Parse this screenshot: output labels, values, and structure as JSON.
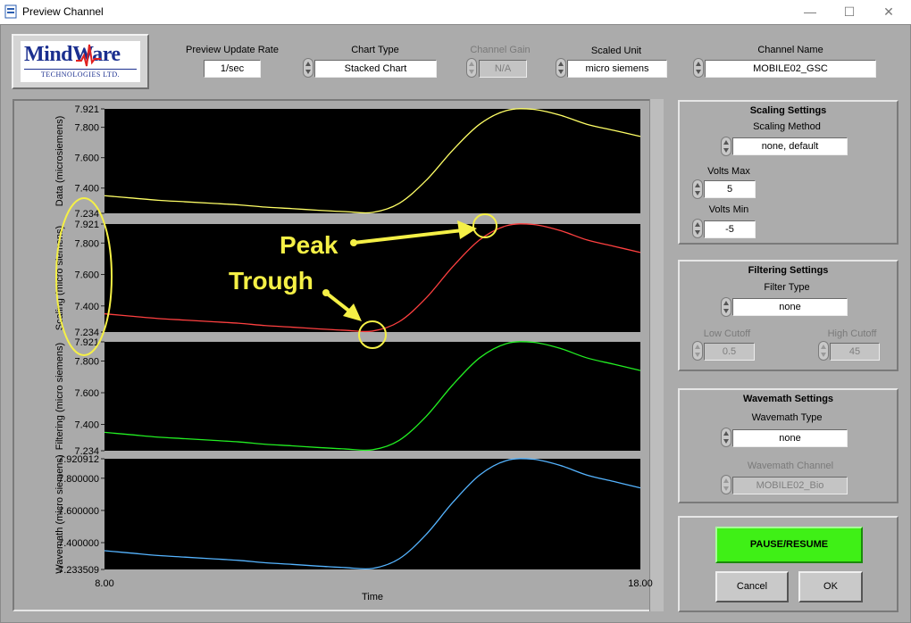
{
  "window": {
    "title": "Preview Channel",
    "minimize": "—",
    "maximize": "☐",
    "close": "✕"
  },
  "logo": {
    "name": "MindWare",
    "subtitle": "TECHNOLOGIES LTD."
  },
  "toolbar": {
    "update_rate": {
      "label": "Preview Update Rate",
      "value": "1/sec"
    },
    "chart_type": {
      "label": "Chart Type",
      "value": "Stacked Chart"
    },
    "channel_gain": {
      "label": "Channel Gain",
      "value": "N/A"
    },
    "scaled_unit": {
      "label": "Scaled Unit",
      "value": "micro siemens"
    },
    "channel_name": {
      "label": "Channel Name",
      "value": "MOBILE02_GSC"
    }
  },
  "scaling": {
    "title": "Scaling Settings",
    "method_label": "Scaling Method",
    "method_value": "none, default",
    "vmax_label": "Volts Max",
    "vmax_value": "5",
    "vmin_label": "Volts Min",
    "vmin_value": "-5"
  },
  "filtering": {
    "title": "Filtering Settings",
    "type_label": "Filter Type",
    "type_value": "none",
    "low_label": "Low Cutoff",
    "low_value": "0.5",
    "high_label": "High Cutoff",
    "high_value": "45"
  },
  "wavemath": {
    "title": "Wavemath Settings",
    "type_label": "Wavemath Type",
    "type_value": "none",
    "channel_label": "Wavemath Channel",
    "channel_value": "MOBILE02_Bio"
  },
  "buttons": {
    "pause": "PAUSE/RESUME",
    "cancel": "Cancel",
    "ok": "OK"
  },
  "annotations": {
    "peak": "Peak",
    "trough": "Trough"
  },
  "colors": {
    "data": "#ffff66",
    "scaling": "#ff4040",
    "filtering": "#22ee22",
    "wavemath": "#55b4ff",
    "annotation": "#f5f046",
    "pause_button": "#3ff016"
  },
  "chart_data": {
    "type": "line",
    "xlabel": "Time",
    "xlim": [
      8,
      18
    ],
    "x_tick_labels": [
      "8.00",
      "18.00"
    ],
    "x": [
      8,
      8.5,
      9,
      9.5,
      10,
      10.5,
      11,
      11.5,
      12,
      12.5,
      13,
      13.5,
      14,
      14.5,
      15,
      15.5,
      16,
      16.5,
      17,
      17.5,
      18
    ],
    "shape": [
      7.35,
      7.335,
      7.32,
      7.31,
      7.3,
      7.29,
      7.275,
      7.265,
      7.254,
      7.245,
      7.24,
      7.3,
      7.45,
      7.65,
      7.82,
      7.91,
      7.918,
      7.88,
      7.82,
      7.78,
      7.74
    ],
    "panels": [
      {
        "ylabel": "Data (microsiemens)",
        "ylim": [
          7.234,
          7.921
        ],
        "y_tick_labels": [
          "7.921",
          "7.800",
          "7.600",
          "7.400",
          "7.234"
        ],
        "y_ticks": [
          7.921,
          7.8,
          7.6,
          7.4,
          7.234
        ],
        "color": "#ffff66"
      },
      {
        "ylabel": "Scaling (micro siemens)",
        "ylim": [
          7.234,
          7.921
        ],
        "y_tick_labels": [
          "7.921",
          "7.800",
          "7.600",
          "7.400",
          "7.234"
        ],
        "y_ticks": [
          7.921,
          7.8,
          7.6,
          7.4,
          7.234
        ],
        "color": "#ff4040"
      },
      {
        "ylabel": "Filtering (micro siemens)",
        "ylim": [
          7.234,
          7.921
        ],
        "y_tick_labels": [
          "7.921",
          "7.800",
          "7.600",
          "7.400",
          "7.234"
        ],
        "y_ticks": [
          7.921,
          7.8,
          7.6,
          7.4,
          7.234
        ],
        "color": "#22ee22"
      },
      {
        "ylabel": "Wavemath (micro siemens)",
        "ylim": [
          7.233509,
          7.920912
        ],
        "y_tick_labels": [
          "7.920912",
          "7.800000",
          "7.600000",
          "7.400000",
          "7.233509"
        ],
        "y_ticks": [
          7.920912,
          7.8,
          7.6,
          7.4,
          7.233509
        ],
        "color": "#55b4ff"
      }
    ],
    "peak": {
      "x": 15.1,
      "y": 7.921
    },
    "trough": {
      "x": 13.0,
      "y": 7.234
    }
  }
}
